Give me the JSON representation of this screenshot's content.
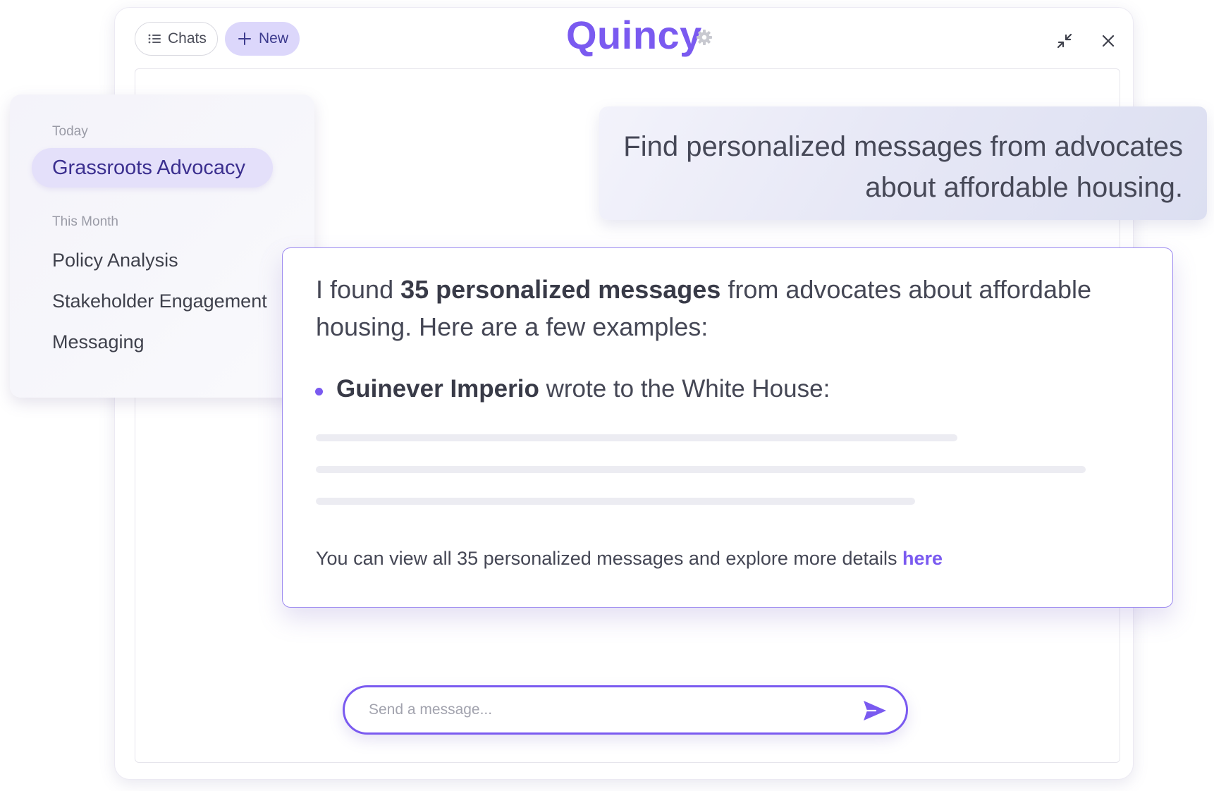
{
  "app": {
    "title": "Quincy"
  },
  "titlebar": {
    "chats_label": "Chats",
    "new_label": "New",
    "icons": {
      "chats": "list-icon",
      "new": "plus-icon",
      "settings": "gear-icon",
      "minimize": "minimize-icon",
      "close": "close-icon"
    }
  },
  "sidebar": {
    "sections": [
      {
        "label": "Today",
        "items": [
          {
            "label": "Grassroots Advocacy",
            "active": true
          }
        ]
      },
      {
        "label": "This Month",
        "items": [
          {
            "label": "Policy Analysis",
            "active": false
          },
          {
            "label": "Stakeholder Engagement",
            "active": false
          },
          {
            "label": "Messaging",
            "active": false
          }
        ]
      }
    ]
  },
  "conversation": {
    "user_message": "Find personalized messages from advocates about affordable housing.",
    "assistant": {
      "intro_prefix": "I found ",
      "intro_bold": "35 personalized messages",
      "intro_suffix": " from advocates about affordable housing. Here are a few examples:",
      "examples": [
        {
          "author": "Guinever Imperio",
          "text": " wrote to the White House:"
        }
      ],
      "footer_text": "You can view all 35 personalized messages and explore more details ",
      "footer_link": "here"
    }
  },
  "composer": {
    "placeholder": "Send a message...",
    "value": ""
  },
  "colors": {
    "accent": "#7a5af0",
    "active_item_bg": "#e4e0fa",
    "new_button_bg": "#dcd7fb",
    "text": "#3f4150",
    "muted": "#9a9ba6"
  }
}
